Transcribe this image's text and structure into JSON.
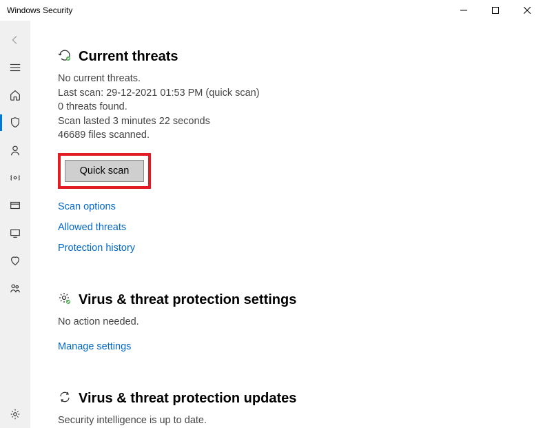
{
  "window": {
    "title": "Windows Security"
  },
  "currentThreats": {
    "title": "Current threats",
    "status": "No current threats.",
    "lastScan": "Last scan: 29-12-2021 01:53 PM (quick scan)",
    "threatsFound": "0 threats found.",
    "duration": "Scan lasted 3 minutes 22 seconds",
    "filesScanned": "46689 files scanned.",
    "quickScanBtn": "Quick scan",
    "links": {
      "scanOptions": "Scan options",
      "allowedThreats": "Allowed threats",
      "protectionHistory": "Protection history"
    }
  },
  "settings": {
    "title": "Virus & threat protection settings",
    "status": "No action needed.",
    "link": "Manage settings"
  },
  "updates": {
    "title": "Virus & threat protection updates",
    "status": "Security intelligence is up to date."
  }
}
